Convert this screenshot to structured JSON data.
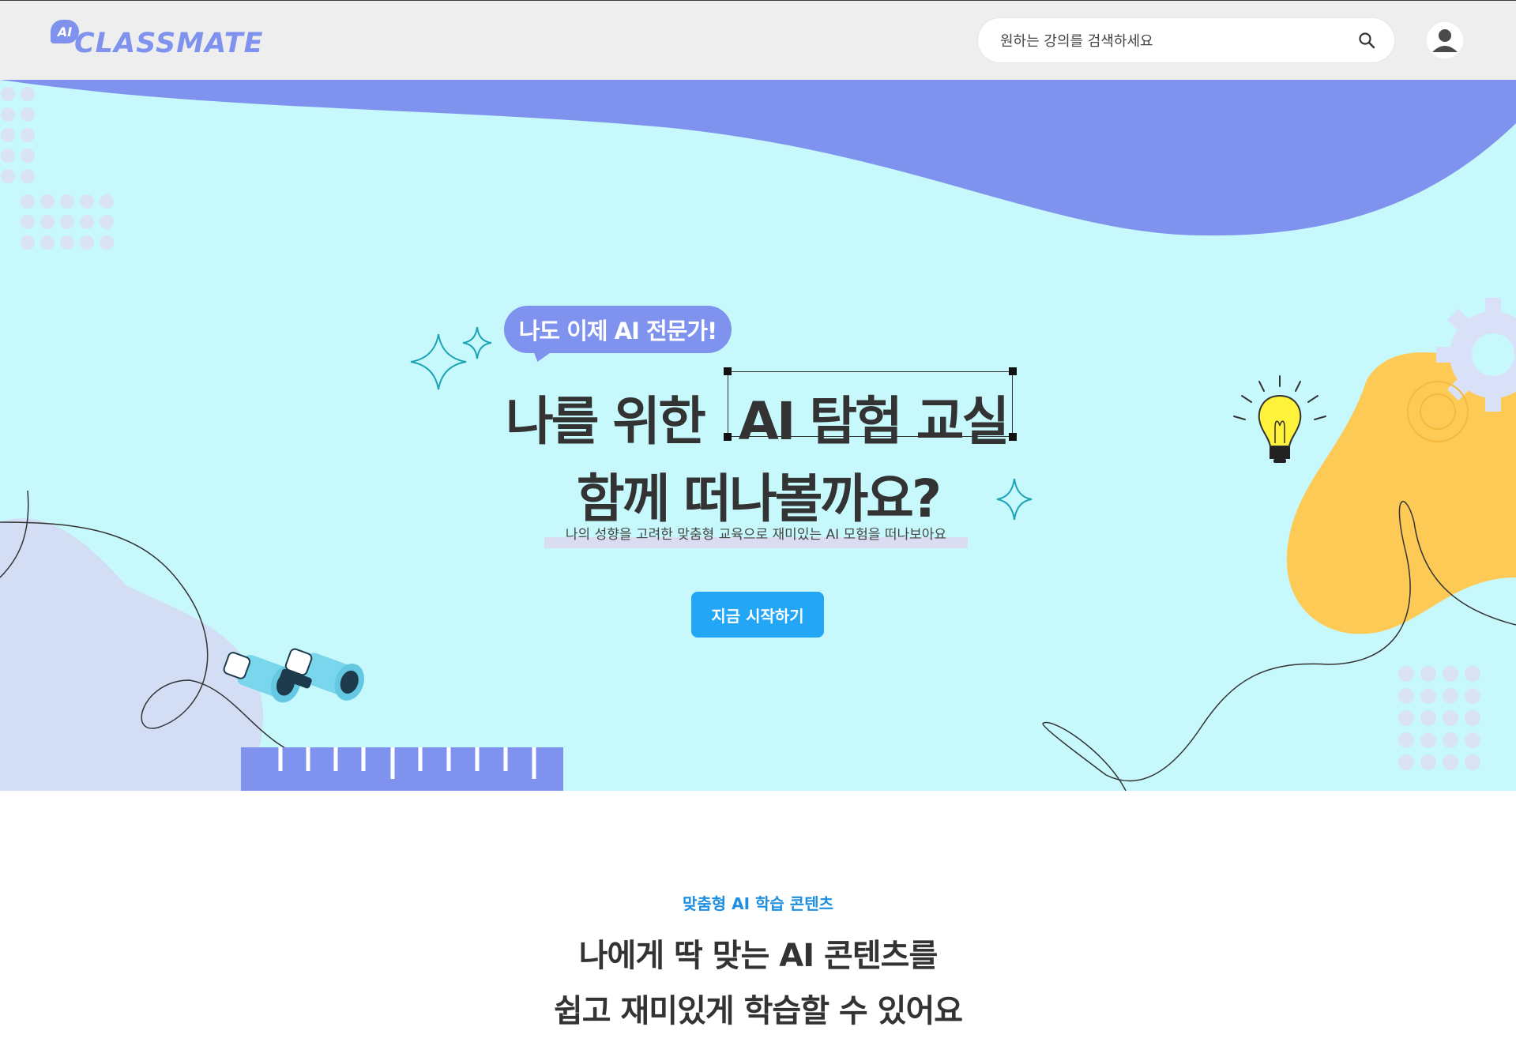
{
  "header": {
    "logo_badge": "AI",
    "logo_text": "CLASSMATE",
    "search_placeholder": "원하는 강의를 검색하세요"
  },
  "hero": {
    "bubble": "나도 이제 AI 전문가!",
    "title_line1_pre": "나를 위한",
    "title_line1_highlight": "AI 탐험 교실",
    "title_line2": "함께 떠나볼까요?",
    "subtitle": "나의 성향을 고려한 맞춤형 교육으로 재미있는 AI 모험을 떠나보아요",
    "cta_label": "지금 시작하기"
  },
  "section": {
    "eyebrow": "맞춤형 AI 학습 콘텐츠",
    "title_line1": "나에게 딱 맞는 AI 콘텐츠를",
    "title_line2": "쉽고 재미있게 학습할 수 있어요"
  },
  "colors": {
    "hero_bg": "#c7f8fc",
    "wave": "#7f92ee",
    "accent_yellow": "#fdca55",
    "cta": "#22a6f5",
    "eyebrow": "#1e8ee0"
  },
  "icons": [
    "search-icon",
    "user-avatar-icon",
    "sparkle-icon",
    "lightbulb-icon",
    "gear-icon",
    "binoculars-icon",
    "ruler-icon"
  ]
}
